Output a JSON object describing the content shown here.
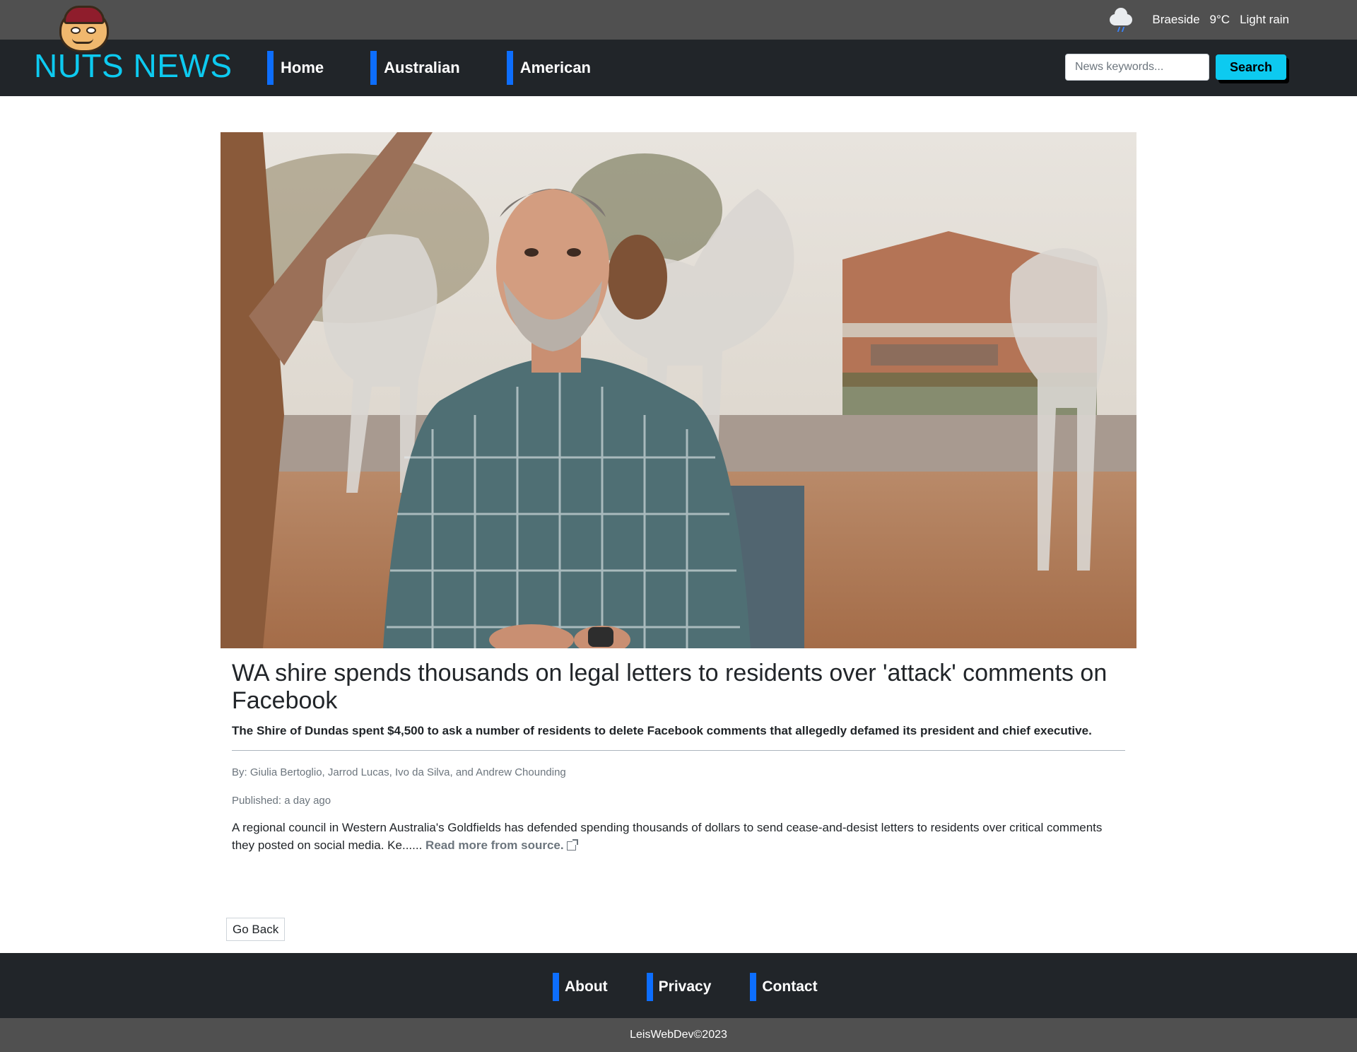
{
  "weather": {
    "icon": "rain-cloud-icon",
    "location": "Braeside",
    "temperature": "9°C",
    "condition": "Light rain"
  },
  "navbar": {
    "brand": "NUTS NEWS",
    "logo_icon": "nut-mascot-logo",
    "links": [
      "Home",
      "Australian",
      "American"
    ],
    "search_placeholder": "News keywords...",
    "search_value": "",
    "search_label": "Search"
  },
  "article": {
    "image": "man-in-plaid-shirt-with-camel-sculptures-photo",
    "title": "WA shire spends thousands on legal letters to residents over 'attack' comments on Facebook",
    "summary": "The Shire of Dundas spent $4,500 to ask a number of residents to delete Facebook comments that allegedly defamed its president and chief executive.",
    "authors": "By: Giulia Bertoglio, Jarrod Lucas, Ivo da Silva, and Andrew Chounding",
    "published": "Published: a day ago",
    "content": "A regional council in Western Australia's Goldfields has defended spending thousands of dollars to send cease-and-desist letters to residents over critical comments they posted on social media.   Ke...... ",
    "read_more": "Read more from source."
  },
  "go_back_label": "Go Back",
  "footer": {
    "links": [
      "About",
      "Privacy",
      "Contact"
    ],
    "copyright": "LeisWebDev©2023"
  },
  "colors": {
    "brand": "#0dcaf0",
    "nav_bg": "#212529",
    "top_bar_bg": "#505050",
    "accent": "#0d6efd"
  }
}
